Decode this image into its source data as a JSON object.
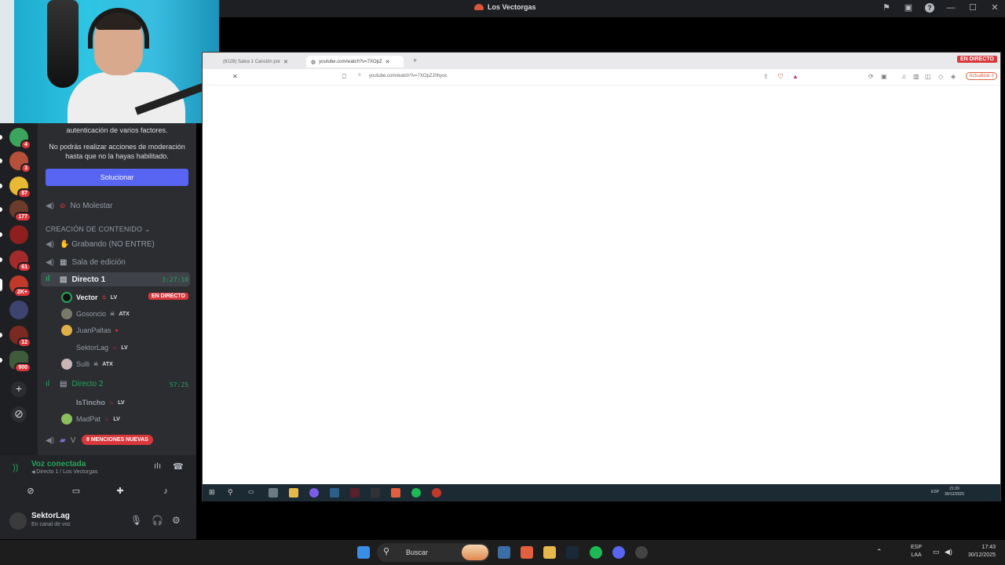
{
  "window": {
    "title": "Los Vectorgas"
  },
  "channels_panel": {
    "notice_line1": "autenticación de varios factores.",
    "notice_line2": "No podrás realizar acciones de moderación",
    "notice_line3": "hasta que no la hayas habilitado.",
    "fix_button": "Solucionar",
    "no_molestar": "No Molestar",
    "category": "CREACIÓN DE CONTENIDO ⌄",
    "grabando": "✋ Grabando (NO ENTRE)",
    "sala_edicion": "Sala de edición",
    "directo1": {
      "name": "Directo 1",
      "timer": "3:27:10",
      "users": [
        {
          "name": "Vector",
          "tag": "LV",
          "live": "EN DIRECTO"
        },
        {
          "name": "Gosoncio",
          "tag": "ATX"
        },
        {
          "name": "JuanPaltas",
          "tag": ""
        },
        {
          "name": "SektorLag",
          "tag": "LV"
        },
        {
          "name": "Sulli",
          "tag": "ATX"
        }
      ]
    },
    "directo2": {
      "name": "Directo 2",
      "timer": "57:25",
      "users": [
        {
          "name": "IsTincho",
          "tag": "LV"
        },
        {
          "name": "MadPat",
          "tag": "LV"
        }
      ]
    },
    "mentions": "8 MENCIONES NUEVAS",
    "partial_channel": "V"
  },
  "servers": {
    "badges": [
      "4",
      "3",
      "87",
      "177",
      "61",
      "2K+",
      "12",
      "900"
    ]
  },
  "voice": {
    "status": "Voz conectada",
    "location": "Directo 1 / Los Vectorgas"
  },
  "user": {
    "name": "SektorLag",
    "status": "En canal de voz"
  },
  "browser": {
    "tab1": "(6128) Salva 1 Canción por",
    "tab2": "youtube.com/watch?v=7XOpZ",
    "live_badge": "EN DIRECTO",
    "url": "youtube.com/watch?v=7XOpZJ0hyoc",
    "update_button": "Actualizar",
    "inner_time": "21:39",
    "inner_date": "30/12/2025",
    "inner_lang": "ESP"
  },
  "taskbar": {
    "search_placeholder": "Buscar",
    "lang_line1": "ESP",
    "lang_line2": "LAA",
    "time": "17:43",
    "date": "30/12/2025"
  },
  "colors": {
    "discord_dark": "#1e1f22",
    "discord_panel": "#2b2d31",
    "blurple": "#5865f2",
    "live_red": "#da373c",
    "voice_green": "#23a55a"
  }
}
